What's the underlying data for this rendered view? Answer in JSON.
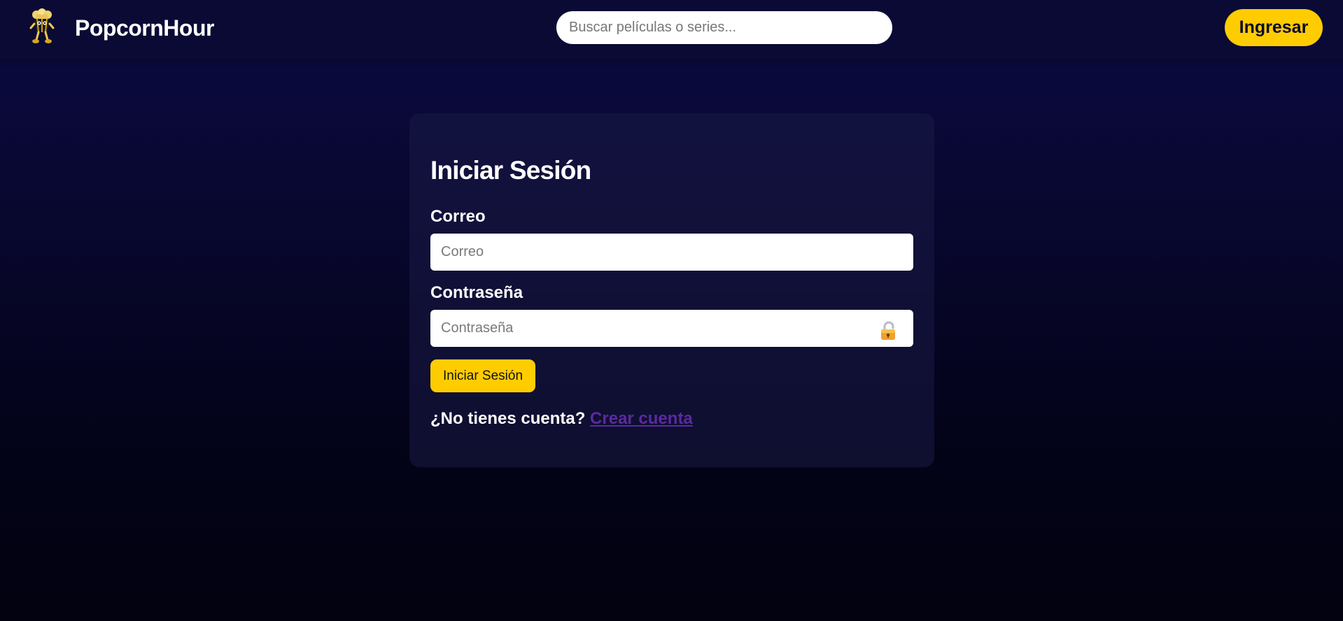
{
  "header": {
    "logo_icon": "popcorn-mascot-icon",
    "brand": "PopcornHour",
    "search_placeholder": "Buscar películas o series...",
    "login_button": "Ingresar"
  },
  "login_card": {
    "title": "Iniciar Sesión",
    "email_label": "Correo",
    "email_placeholder": "Correo",
    "password_label": "Contraseña",
    "password_placeholder": "Contraseña",
    "password_icon": "lock-icon",
    "submit_label": "Iniciar Sesión",
    "signup_prompt": "¿No tienes cuenta?",
    "signup_link": "Crear cuenta"
  },
  "colors": {
    "accent": "#ffcc00",
    "background_top": "#0b0a45",
    "background_bottom": "#020210",
    "link": "#5a2aa0"
  }
}
